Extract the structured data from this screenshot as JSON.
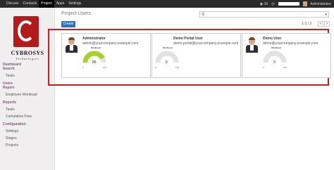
{
  "topbar": {
    "nav": [
      "Discuss",
      "Contacts",
      "Project",
      "Apps",
      "Settings"
    ],
    "active": "Project",
    "messages_count": "10",
    "user": "Administrator"
  },
  "brand": {
    "name": "CYBROSYS",
    "tagline": "Technologies"
  },
  "sidebar": {
    "sections": [
      {
        "title": "Dashboard",
        "subtitle": "Search",
        "items": [
          "Tasks"
        ]
      },
      {
        "title": "Users",
        "subtitle": "Report",
        "items": [
          "Employee Workload"
        ]
      },
      {
        "title": "Reports",
        "items": [
          "Tasks",
          "Cumulative Flow"
        ]
      },
      {
        "title": "Configuration",
        "items": [
          "Settings",
          "Stages",
          "Projects"
        ]
      }
    ]
  },
  "main": {
    "title": "Project Users",
    "create_label": "Create",
    "pager": "1-3 / 3",
    "prev": "<",
    "next": ">"
  },
  "cards": [
    {
      "name": "Administrator",
      "email": "admin@yourcompany.example.com",
      "gauge_label": "Workload",
      "workload": 85,
      "min": "0",
      "max": "100",
      "color": "#a5d22b",
      "has_photo": true
    },
    {
      "name": "Demo Portal User",
      "email": "demo.portal@yourcompany.example.com",
      "gauge_label": "Workload",
      "workload": 0,
      "min": "0",
      "max": "100",
      "color": "#dddddd",
      "has_photo": false
    },
    {
      "name": "Demo User",
      "email": "demo@yourcompany.example.com",
      "gauge_label": "Workload",
      "workload": 0,
      "min": "0",
      "max": "100",
      "color": "#dddddd",
      "has_photo": true
    }
  ]
}
